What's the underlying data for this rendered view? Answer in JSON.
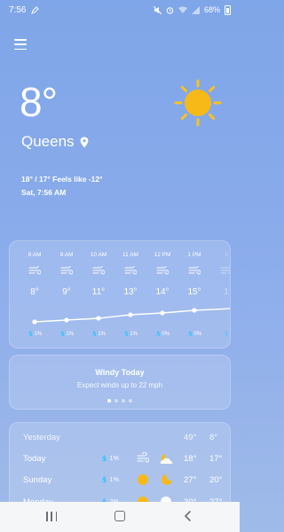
{
  "status_bar": {
    "time": "7:56",
    "battery": "68%"
  },
  "current": {
    "temperature": "8°",
    "location": "Queens",
    "feels_like": "18° / 17° Feels like -12°",
    "datetime": "Sat, 7:56 AM",
    "icon": "sun-icon"
  },
  "hourly": [
    {
      "time": "8 AM",
      "temp": "8°",
      "precip": "1%",
      "icon": "wind-icon"
    },
    {
      "time": "9 AM",
      "temp": "9°",
      "precip": "1%",
      "icon": "wind-icon"
    },
    {
      "time": "10 AM",
      "temp": "11°",
      "precip": "1%",
      "icon": "wind-icon"
    },
    {
      "time": "11 AM",
      "temp": "13°",
      "precip": "1%",
      "icon": "wind-icon"
    },
    {
      "time": "12 PM",
      "temp": "14°",
      "precip": "0%",
      "icon": "wind-icon"
    },
    {
      "time": "1 PM",
      "temp": "15°",
      "precip": "0%",
      "icon": "wind-icon"
    },
    {
      "time": "2",
      "temp": "1",
      "precip": "",
      "icon": "wind-icon"
    }
  ],
  "windy_card": {
    "title": "Windy Today",
    "subtitle": "Expect winds up to 22 mph",
    "dots": 4,
    "active_dot": 0
  },
  "daily": [
    {
      "day": "Yesterday",
      "precip": "",
      "icons": [],
      "hi": "49°",
      "lo": "8°"
    },
    {
      "day": "Today",
      "precip": "1%",
      "icons": [
        "wind-icon",
        "partly-cloudy-night-icon"
      ],
      "hi": "18°",
      "lo": "17°"
    },
    {
      "day": "Sunday",
      "precip": "1%",
      "icons": [
        "sun-icon",
        "moon-icon"
      ],
      "hi": "27°",
      "lo": "20°"
    },
    {
      "day": "Monday",
      "precip": "2%",
      "icons": [
        "sun-icon",
        "moon-icon"
      ],
      "hi": "30°",
      "lo": "27°"
    }
  ],
  "colors": {
    "sun": "#f7b918",
    "sun_ray": "#f9c21d",
    "background_top": "#7fa6e8"
  }
}
